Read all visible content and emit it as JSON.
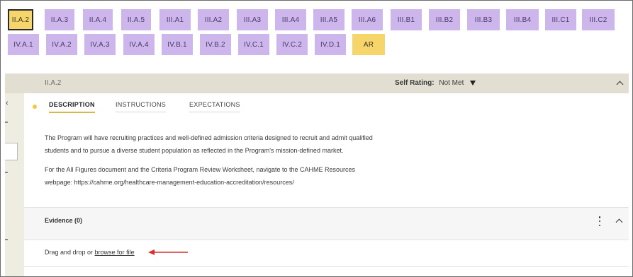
{
  "tabs": {
    "row1": [
      "II.A.2",
      "II.A.3",
      "II.A.4",
      "II.A.5",
      "III.A1",
      "III.A2",
      "III.A3",
      "III.A4",
      "III.A5",
      "III.A6",
      "III.B1",
      "III.B2",
      "III.B3",
      "III.B4",
      "III.C1",
      "III.C2"
    ],
    "row2": [
      "IV.A.1",
      "IV.A.2",
      "IV.A.3",
      "IV.A.4",
      "IV.B.1",
      "IV.B.2",
      "IV.C.1",
      "IV.C.2",
      "IV.D.1",
      "AR"
    ],
    "active": "II.A.2"
  },
  "header": {
    "code": "II.A.2",
    "self_rating_label": "Self Rating:",
    "self_rating_value": "Not Met"
  },
  "inner_tabs": {
    "description": "DESCRIPTION",
    "instructions": "INSTRUCTIONS",
    "expectations": "EXPECTATIONS"
  },
  "description": {
    "p1": "The Program will have recruiting practices and well-defined admission criteria designed to recruit and admit qualified students and to pursue a diverse student population as reflected in the Program's mission-defined market.",
    "p2": "For the All Figures document and the Criteria Program Review Worksheet, navigate to the CAHME Resources webpage: https://cahme.org/healthcare-management-education-accreditation/resources/"
  },
  "evidence": {
    "label": "Evidence (0)"
  },
  "upload": {
    "prefix": "Drag and drop or ",
    "link": "browse for file"
  },
  "colors": {
    "tab_purple": "#cdb6ec",
    "tab_yellow": "#f6d66a",
    "header_bg": "#e2dfd2",
    "arrow_red": "#d9302b"
  }
}
